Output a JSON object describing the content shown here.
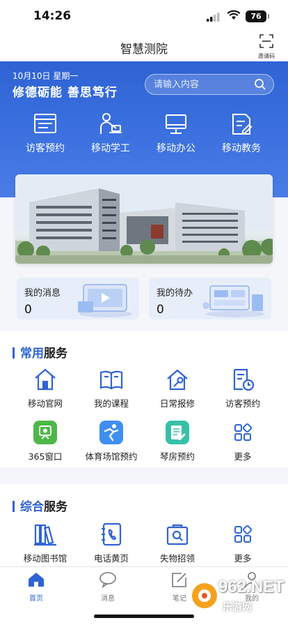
{
  "status": {
    "time": "14:26",
    "battery": "76"
  },
  "header": {
    "title": "智慧测院",
    "invite_label": "邀请码"
  },
  "hero": {
    "date": "10月10日 星期一",
    "motto": "修德砺能  善思笃行",
    "search_placeholder": "请输入内容"
  },
  "quick_actions": [
    {
      "label": "访客预约",
      "icon": "visitor-form-icon"
    },
    {
      "label": "移动学工",
      "icon": "student-desk-icon"
    },
    {
      "label": "移动办公",
      "icon": "monitor-icon"
    },
    {
      "label": "移动教务",
      "icon": "document-edit-icon"
    }
  ],
  "banner": {
    "image": "campus-building-photo"
  },
  "cards": [
    {
      "title": "我的消息",
      "count": "0"
    },
    {
      "title": "我的待办",
      "count": "0"
    }
  ],
  "common_services": {
    "title_a": "常用",
    "title_b": "服务",
    "items": [
      {
        "label": "移动官网",
        "icon": "home-icon"
      },
      {
        "label": "我的课程",
        "icon": "open-book-icon"
      },
      {
        "label": "日常报修",
        "icon": "repair-house-icon"
      },
      {
        "label": "访客预约",
        "icon": "visitor-clock-icon"
      },
      {
        "label": "365窗口",
        "icon": "window-365-icon"
      },
      {
        "label": "体育场馆预约",
        "icon": "sports-icon"
      },
      {
        "label": "琴房预约",
        "icon": "piano-room-icon"
      },
      {
        "label": "更多",
        "icon": "more-grid-icon"
      }
    ]
  },
  "general_services": {
    "title_a": "综合",
    "title_b": "服务",
    "items": [
      {
        "label": "移动图书馆",
        "icon": "library-icon"
      },
      {
        "label": "电话黄页",
        "icon": "phone-book-icon"
      },
      {
        "label": "失物招领",
        "icon": "lost-found-icon"
      },
      {
        "label": "更多",
        "icon": "more-grid-icon"
      }
    ]
  },
  "tabbar": [
    {
      "label": "首页",
      "active": true
    },
    {
      "label": "消息",
      "active": false
    },
    {
      "label": "笔记",
      "active": false
    },
    {
      "label": "我的",
      "active": false
    }
  ],
  "watermark": {
    "text": "962.NET",
    "sub": "乐游网"
  },
  "colors": {
    "primary": "#2f63d4",
    "page_bg": "#f4f6fa",
    "card_bg": "#e8eef9"
  }
}
